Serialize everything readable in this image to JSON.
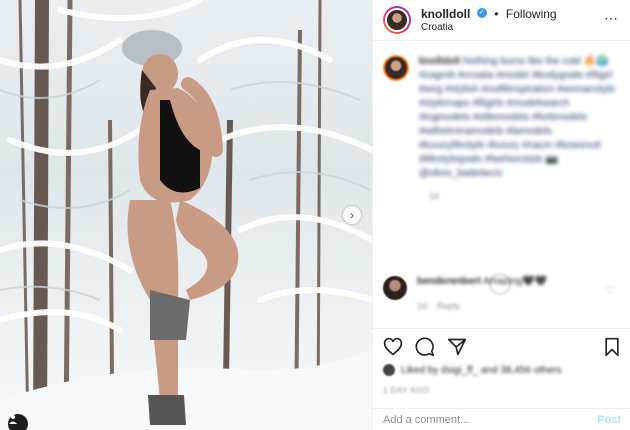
{
  "header": {
    "username": "knolldoll",
    "follow_status": "Following",
    "separator": "•",
    "location": "Croatia",
    "more_icon": "⋯"
  },
  "caption": {
    "username": "knolldoll",
    "text": "Nothing burns like the cold 🔥🌍 #zagreb #croatia #model #bodygoals #fitgirl #wcg #stylish #outfitinspiration #womanstyle #stylemaps #fitgirls #modelsearch #ingmodels #elitemodels #forbmodels #wilhelminamodels #lamodels #luxurylifestyle #luxury #nacm #bowsnutt #lifestylegoals #fashionstyle 📷 @olivio_badelarcic",
    "time": "1d"
  },
  "comment": {
    "username": "benderenbert",
    "text": "Amazing🖤🖤",
    "time": "1d",
    "reply_label": "Reply",
    "like_icon": "♡"
  },
  "likes": {
    "text": "Liked by dsigi_ff_ and 38,456 others"
  },
  "post_time": "1 DAY AGO",
  "comment_box": {
    "placeholder": "Add a comment...",
    "post_label": "Post"
  },
  "photo": {
    "next_icon": "›"
  },
  "icons": {
    "like": "heart-icon",
    "comment": "comment-icon",
    "share": "share-icon",
    "save": "bookmark-icon"
  },
  "colors": {
    "link_blue": "#1f3a6b",
    "verified_blue": "#3897f0",
    "post_disabled": "#b2dffc"
  }
}
